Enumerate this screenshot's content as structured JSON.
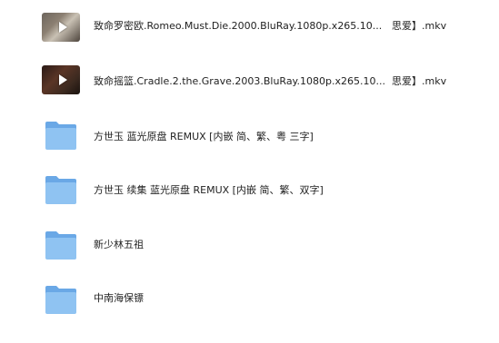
{
  "files": [
    {
      "type": "video",
      "name": "致命罗密欧.Romeo.Must.Die.2000.BluRay.1080p.x265.10...",
      "tail": "思爱】.mkv"
    },
    {
      "type": "video",
      "name": "致命摇篮.Cradle.2.the.Grave.2003.BluRay.1080p.x265.10...",
      "tail": "思爱】.mkv"
    },
    {
      "type": "folder",
      "name": "方世玉 蓝光原盘 REMUX [内嵌 简、繁、粤 三字]"
    },
    {
      "type": "folder",
      "name": "方世玉 续集 蓝光原盘 REMUX [内嵌 简、繁、双字]"
    },
    {
      "type": "folder",
      "name": "新少林五祖"
    },
    {
      "type": "folder",
      "name": "中南海保镖"
    }
  ],
  "colors": {
    "folder_front": "#8fc3f2",
    "folder_back": "#6aa8e6",
    "text": "#222222"
  },
  "icons": {
    "video": "play-icon",
    "folder": "folder-icon"
  }
}
